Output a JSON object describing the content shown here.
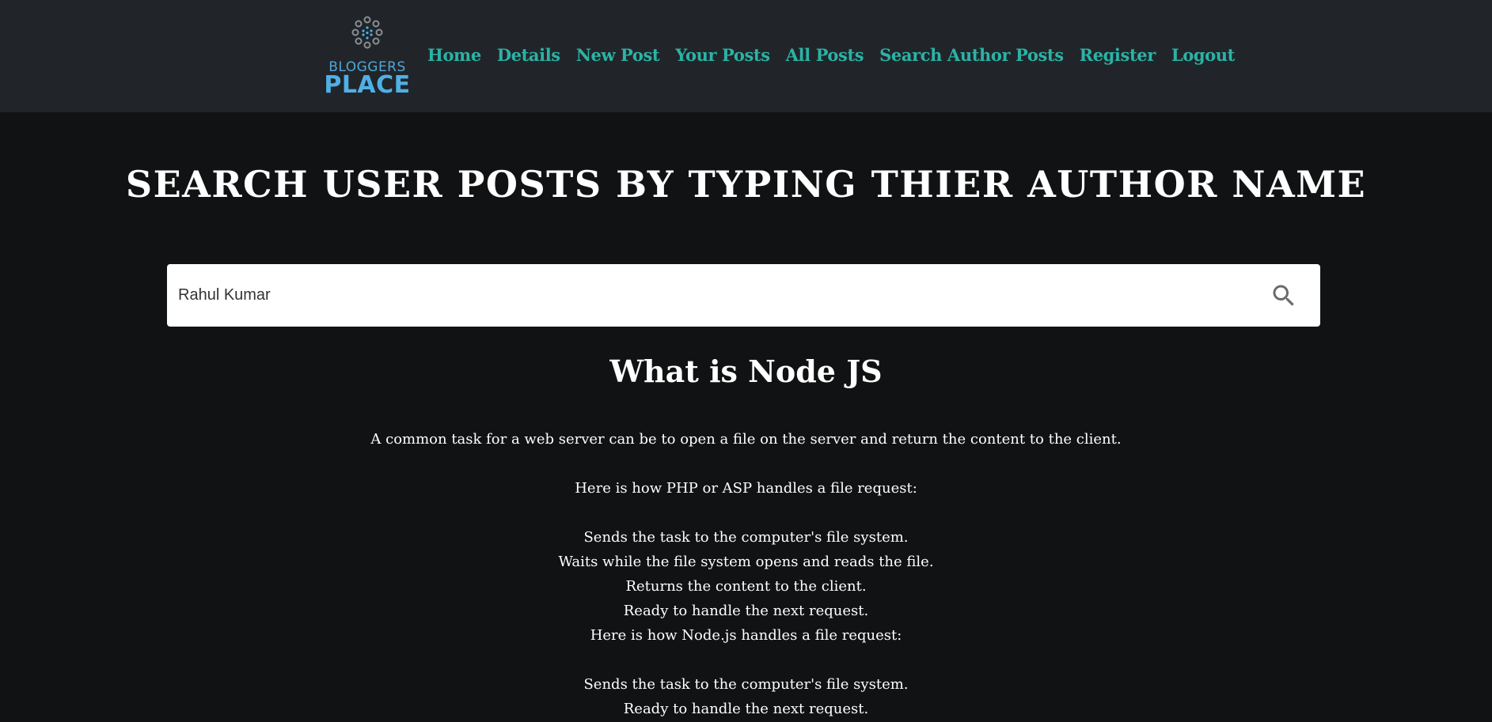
{
  "logo": {
    "top_text": "BLOGGERS",
    "bottom_text": "PLACE",
    "colors": {
      "mark": "#8a8f94",
      "accent": "#4fb0e6"
    }
  },
  "nav": {
    "items": [
      {
        "label": "Home"
      },
      {
        "label": "Details"
      },
      {
        "label": "New Post"
      },
      {
        "label": "Your Posts"
      },
      {
        "label": "All Posts"
      },
      {
        "label": "Search Author Posts"
      },
      {
        "label": "Register"
      },
      {
        "label": "Logout"
      }
    ],
    "color": "#2bb3a6"
  },
  "page": {
    "title": "SEARCH USER POSTS BY TYPING THIER AUTHOR NAME"
  },
  "search": {
    "value": "Rahul Kumar",
    "icon": "search-icon"
  },
  "post": {
    "title": "What is Node JS",
    "lines": [
      "A common task for a web server can be to open a file on the server and return the content to the client.",
      "",
      "Here is how PHP or ASP handles a file request:",
      "",
      "Sends the task to the computer's file system.",
      "Waits while the file system opens and reads the file.",
      "Returns the content to the client.",
      "Ready to handle the next request.",
      "Here is how Node.js handles a file request:",
      "",
      "Sends the task to the computer's file system.",
      "Ready to handle the next request."
    ]
  }
}
